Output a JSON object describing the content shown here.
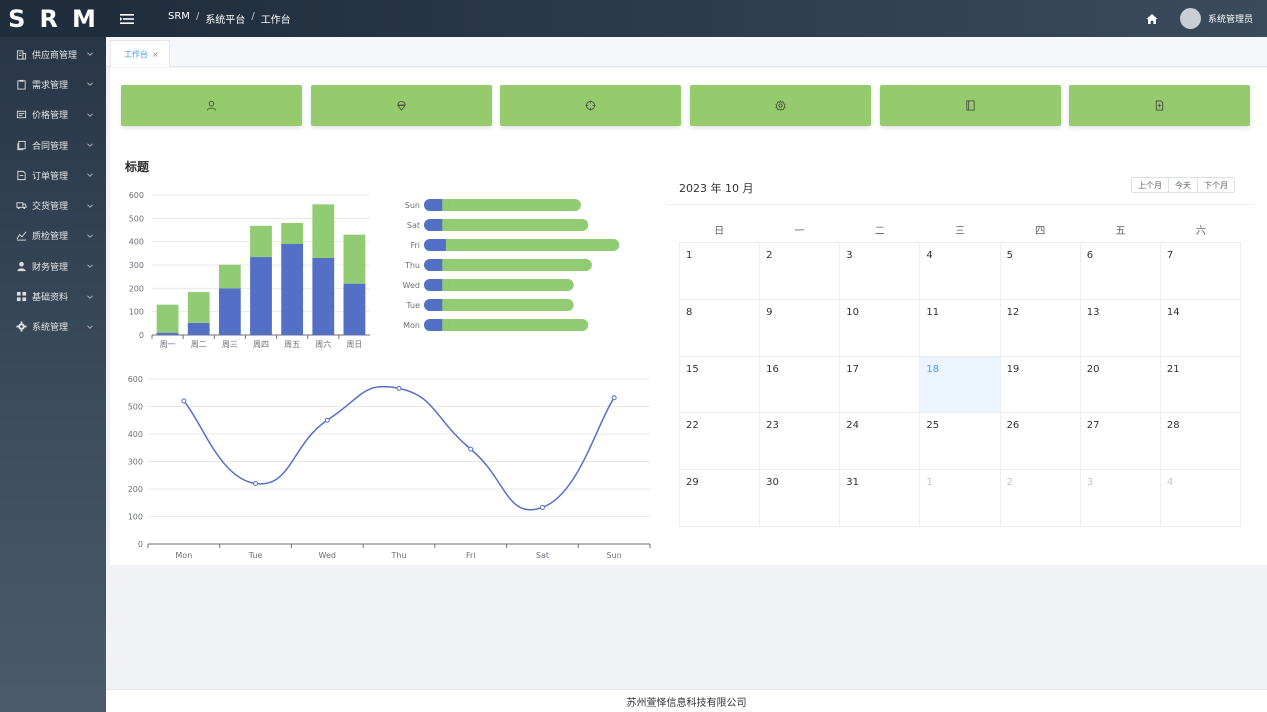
{
  "app": {
    "logo": "SRM",
    "username": "系统管理员"
  },
  "breadcrumb": [
    "SRM",
    "系统平台",
    "工作台"
  ],
  "tab": {
    "label": "工作台",
    "close": "×"
  },
  "sidebar": {
    "items": [
      {
        "label": "供应商管理",
        "icon": "building-icon"
      },
      {
        "label": "需求管理",
        "icon": "clipboard-icon"
      },
      {
        "label": "价格管理",
        "icon": "price-tag-icon"
      },
      {
        "label": "合同管理",
        "icon": "document-copy-icon"
      },
      {
        "label": "订单管理",
        "icon": "order-icon"
      },
      {
        "label": "交货管理",
        "icon": "truck-icon"
      },
      {
        "label": "质检管理",
        "icon": "chart-icon"
      },
      {
        "label": "财务管理",
        "icon": "user-filled-icon"
      },
      {
        "label": "基础资料",
        "icon": "grid-icon"
      },
      {
        "label": "系统管理",
        "icon": "gear-filled-icon"
      }
    ]
  },
  "shortcuts": [
    {
      "icon": "user-icon"
    },
    {
      "icon": "ice-cream-icon"
    },
    {
      "icon": "aim-icon"
    },
    {
      "icon": "setting-icon"
    },
    {
      "icon": "notebook-icon"
    },
    {
      "icon": "document-icon"
    }
  ],
  "panel": {
    "title": "标题"
  },
  "chart_data": [
    {
      "type": "bar",
      "stacked": true,
      "categories": [
        "周一",
        "周二",
        "周三",
        "周四",
        "周五",
        "周六",
        "周日"
      ],
      "series": [
        {
          "values": [
            10,
            52,
            200,
            334,
            390,
            330,
            220
          ],
          "color": "#5470c6"
        },
        {
          "values": [
            120,
            132,
            101,
            134,
            90,
            230,
            210
          ],
          "color": "#91cc75"
        }
      ],
      "ylim": [
        0,
        600
      ],
      "yticks": [
        0,
        100,
        200,
        300,
        400,
        500,
        600
      ],
      "grid": true
    },
    {
      "type": "bar",
      "orientation": "horizontal",
      "categories": [
        "Mon",
        "Tue",
        "Wed",
        "Thu",
        "Fri",
        "Sat",
        "Sun"
      ],
      "series": [
        {
          "values": [
            10,
            10,
            10,
            10,
            12,
            10,
            10
          ],
          "color": "#5470c6"
        },
        {
          "values": [
            90,
            82,
            82,
            92,
            107,
            90,
            86
          ],
          "color": "#91cc75"
        }
      ],
      "xlim": [
        0,
        120
      ],
      "grid": false
    },
    {
      "type": "line",
      "smooth": true,
      "categories": [
        "Mon",
        "Tue",
        "Wed",
        "Thu",
        "Fri",
        "Sat",
        "Sun"
      ],
      "values": [
        520,
        220,
        450,
        566,
        345,
        133,
        532
      ],
      "ylim": [
        0,
        600
      ],
      "yticks": [
        0,
        100,
        200,
        300,
        400,
        500,
        600
      ],
      "color": "#5470c6",
      "grid": true
    }
  ],
  "calendar": {
    "title": "2023 年 10 月",
    "buttons": {
      "prev": "上个月",
      "today": "今天",
      "next": "下个月"
    },
    "weekdays": [
      "日",
      "一",
      "二",
      "三",
      "四",
      "五",
      "六"
    ],
    "days": [
      {
        "d": "1"
      },
      {
        "d": "2"
      },
      {
        "d": "3"
      },
      {
        "d": "4"
      },
      {
        "d": "5"
      },
      {
        "d": "6"
      },
      {
        "d": "7"
      },
      {
        "d": "8"
      },
      {
        "d": "9"
      },
      {
        "d": "10"
      },
      {
        "d": "11"
      },
      {
        "d": "12"
      },
      {
        "d": "13"
      },
      {
        "d": "14"
      },
      {
        "d": "15"
      },
      {
        "d": "16"
      },
      {
        "d": "17"
      },
      {
        "d": "18",
        "today": true
      },
      {
        "d": "19"
      },
      {
        "d": "20"
      },
      {
        "d": "21"
      },
      {
        "d": "22"
      },
      {
        "d": "23"
      },
      {
        "d": "24"
      },
      {
        "d": "25"
      },
      {
        "d": "26"
      },
      {
        "d": "27"
      },
      {
        "d": "28"
      },
      {
        "d": "29"
      },
      {
        "d": "30"
      },
      {
        "d": "31"
      },
      {
        "d": "1",
        "other": true
      },
      {
        "d": "2",
        "other": true
      },
      {
        "d": "3",
        "other": true
      },
      {
        "d": "4",
        "other": true
      }
    ]
  },
  "footer": {
    "text": "苏州萱怿信息科技有限公司"
  },
  "colors": {
    "accent": "#409eff",
    "shortcut": "#95cb6c",
    "bar_blue": "#5470c6",
    "bar_green": "#91cc75"
  }
}
